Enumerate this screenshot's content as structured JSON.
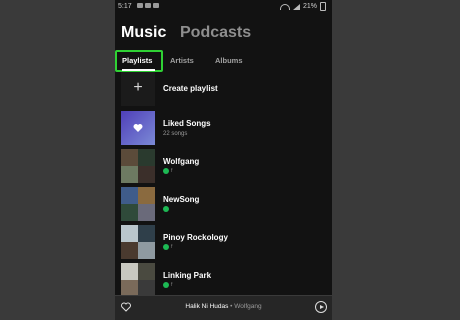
{
  "status_bar": {
    "time": "5:17",
    "battery": "21%"
  },
  "headings": {
    "music": "Music",
    "podcasts": "Podcasts"
  },
  "tabs": [
    {
      "label": "Playlists",
      "active": true
    },
    {
      "label": "Artists"
    },
    {
      "label": "Albums"
    }
  ],
  "create": {
    "label": "Create playlist",
    "icon": "plus-icon"
  },
  "liked": {
    "title": "Liked Songs",
    "subtitle": "22 songs",
    "icon": "heart-icon"
  },
  "playlists": [
    {
      "title": "Wolfgang",
      "downloaded": true,
      "meta": "f"
    },
    {
      "title": "NewSong",
      "downloaded": true,
      "meta": ""
    },
    {
      "title": "Pinoy Rockology",
      "downloaded": true,
      "meta": "f"
    },
    {
      "title": "Linking Park",
      "downloaded": true,
      "meta": "f"
    }
  ],
  "now_playing": {
    "song": "Halik Ni Hudas",
    "separator": " • ",
    "artist": "Wolfgang"
  },
  "colors": {
    "accent_green": "#1db954",
    "highlight_box": "#2fd134",
    "background": "#121212"
  }
}
